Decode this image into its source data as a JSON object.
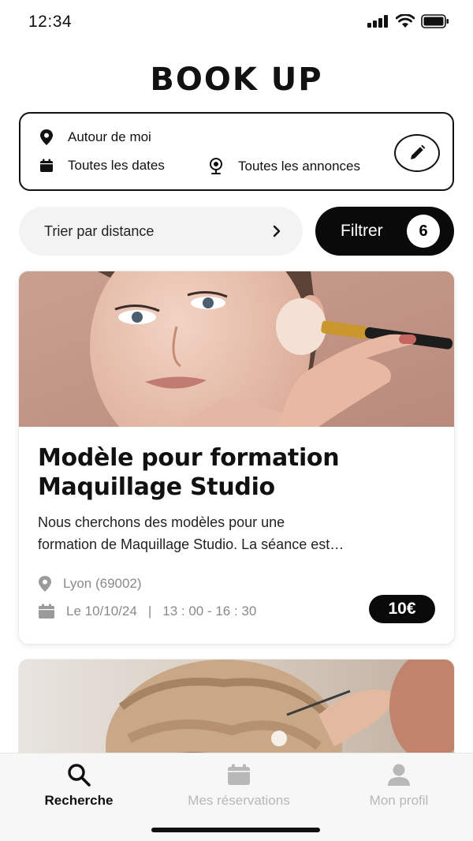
{
  "status_bar": {
    "time": "12:34"
  },
  "app": {
    "title": "BOOK UP"
  },
  "search": {
    "location": "Autour de moi",
    "dates": "Toutes les dates",
    "ads": "Toutes les annonces"
  },
  "sort": {
    "label": "Trier par distance"
  },
  "filter": {
    "label": "Filtrer",
    "count": "6"
  },
  "listings": [
    {
      "title_line1": "Modèle pour formation",
      "title_line2": "Maquillage Studio",
      "description_line1": "Nous cherchons des modèles pour une",
      "description_line2": "formation de Maquillage Studio. La séance est…",
      "location": "Lyon  (69002)",
      "date": "Le 10/10/24",
      "time": "13 : 00 - 16 : 30",
      "price": "10€"
    }
  ],
  "nav": {
    "search": "Recherche",
    "bookings": "Mes réservations",
    "profile": "Mon profil"
  },
  "colors": {
    "primary": "#0a0a0a",
    "muted": "#8a8a8a",
    "nav_inactive": "#b8b8b8",
    "sort_bg": "#f3f3f3"
  },
  "icons": [
    "map-pin-icon",
    "calendar-icon",
    "globe-pin-icon",
    "pencil-icon",
    "chevron-right-icon",
    "search-icon",
    "user-icon"
  ]
}
